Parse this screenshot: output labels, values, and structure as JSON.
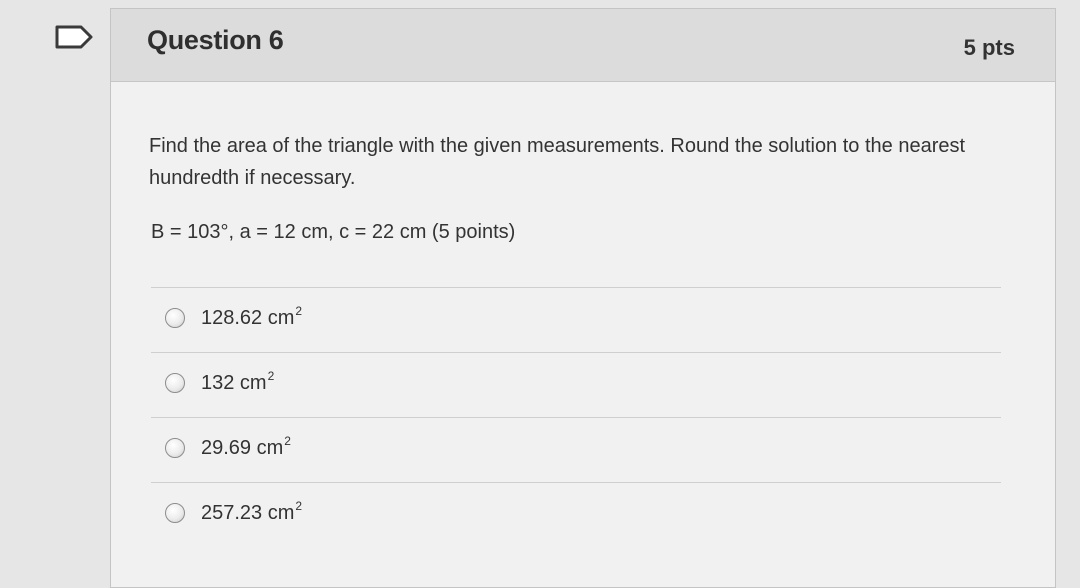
{
  "question": {
    "title": "Question 6",
    "points": "5 pts",
    "prompt": "Find the area of the triangle with the given measurements. Round the solution to the nearest hundredth if necessary.",
    "given": "B = 103°, a = 12 cm, c = 22 cm (5 points)"
  },
  "answers": [
    {
      "value": "128.62 cm",
      "sup": "2",
      "selected": false
    },
    {
      "value": "132 cm",
      "sup": "2",
      "selected": false
    },
    {
      "value": "29.69 cm",
      "sup": "2",
      "selected": false
    },
    {
      "value": "257.23 cm",
      "sup": "2",
      "selected": false
    }
  ]
}
